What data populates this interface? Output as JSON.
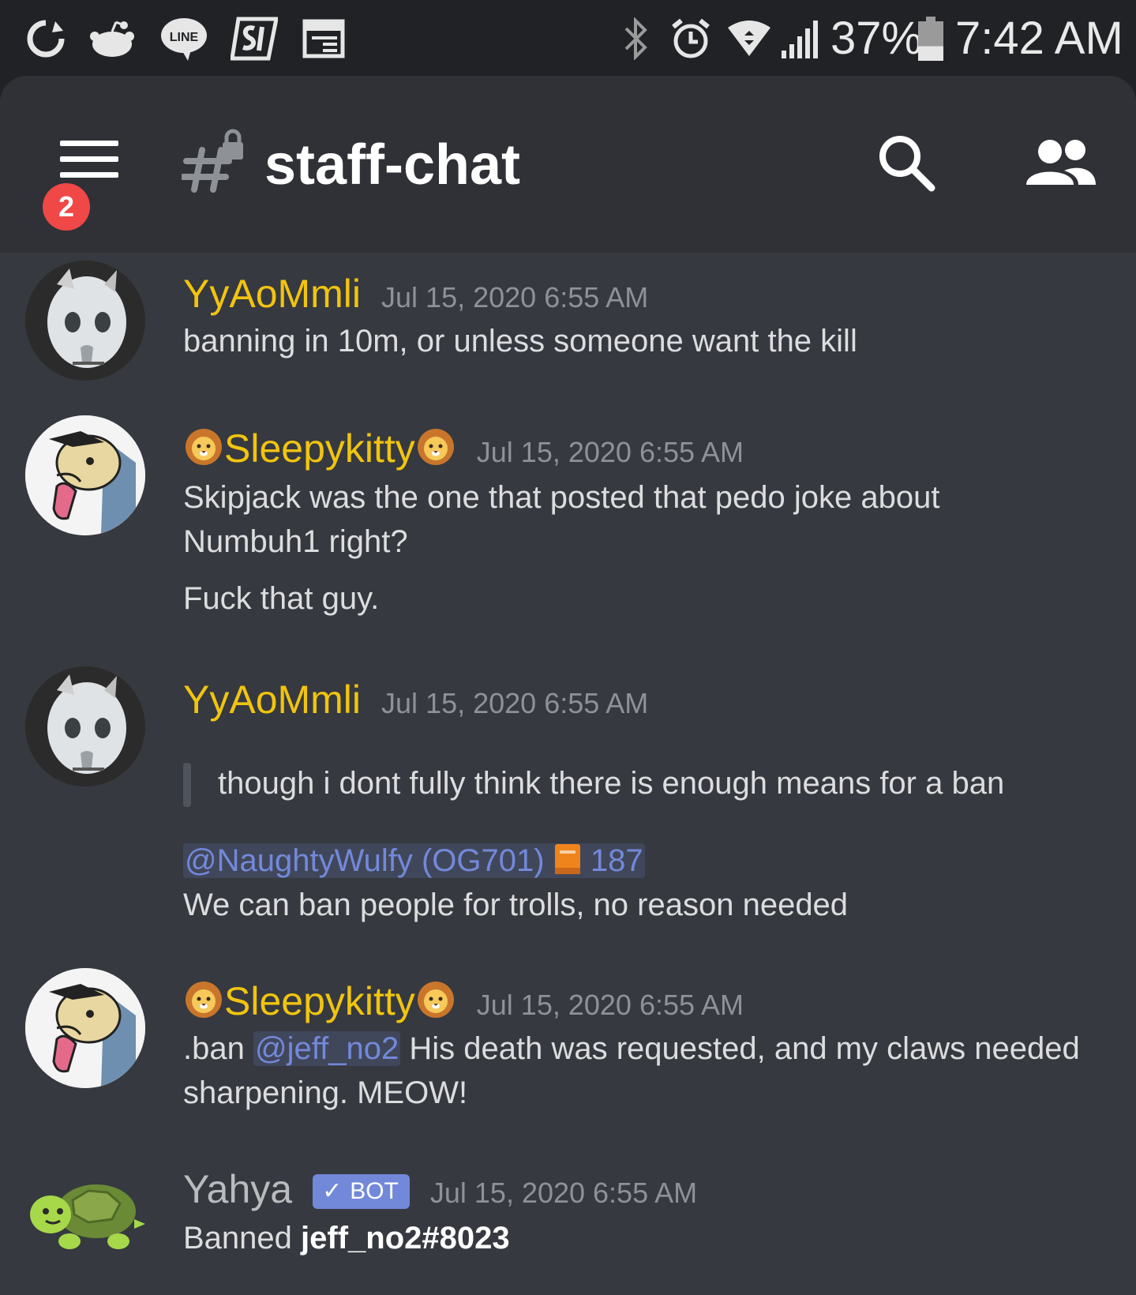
{
  "status_bar": {
    "battery_percent": "37%",
    "battery_level": 0.37,
    "time": "7:42 AM",
    "line_label": "LINE",
    "left_icons": [
      "sync-icon",
      "reddit-icon",
      "line-app-icon",
      "sd-app-icon",
      "calendar-icon"
    ],
    "right_icons": [
      "bluetooth-icon",
      "alarm-icon",
      "wifi-icon",
      "signal-icon",
      "battery-icon"
    ]
  },
  "header": {
    "channel_name": "staff-chat",
    "channel_icon": "locked-hash-icon",
    "unread_badge": "2",
    "icons": [
      "menu-icon",
      "search-icon",
      "members-icon"
    ]
  },
  "messages": [
    {
      "author": "YyAoMmli",
      "timestamp": "Jul 15, 2020 6:55 AM",
      "lines": [
        "banning in 10m, or unless someone want the kill"
      ]
    },
    {
      "author": "Sleepykitty",
      "author_emoji": "lion-emoji",
      "timestamp": "Jul 15, 2020 6:55 AM",
      "lines": [
        "Skipjack was the one that posted that pedo joke about",
        "Numbuh1 right?",
        "Fuck that guy."
      ]
    },
    {
      "author": "YyAoMmli",
      "timestamp": "Jul 15, 2020 6:55 AM",
      "quote": "though i dont fully think there is enough means for a ban",
      "mention": "@NaughtyWulfy (OG701)",
      "mention_suffix": "187",
      "mention_emoji": "orange-book-emoji",
      "lines": [
        "We can ban people for trolls, no reason needed"
      ]
    },
    {
      "author": "Sleepykitty",
      "author_emoji": "lion-emoji",
      "timestamp": "Jul 15, 2020 6:55 AM",
      "command": ".ban",
      "mention": "@jeff_no2",
      "text_after_mention": "His death was requested, and my claws needed",
      "text_line2": "sharpening.  MEOW!"
    },
    {
      "author": "Yahya",
      "bot_label": "BOT",
      "timestamp": "Jul 15, 2020 6:55 AM",
      "prefix": "Banned",
      "bold": "jeff_no2#8023"
    }
  ],
  "colors": {
    "background": "#36393f",
    "header": "#2f3136",
    "status_bar": "#202225",
    "author_gold": "#f1c40f",
    "mention": "#7289da",
    "badge_red": "#f04747"
  }
}
